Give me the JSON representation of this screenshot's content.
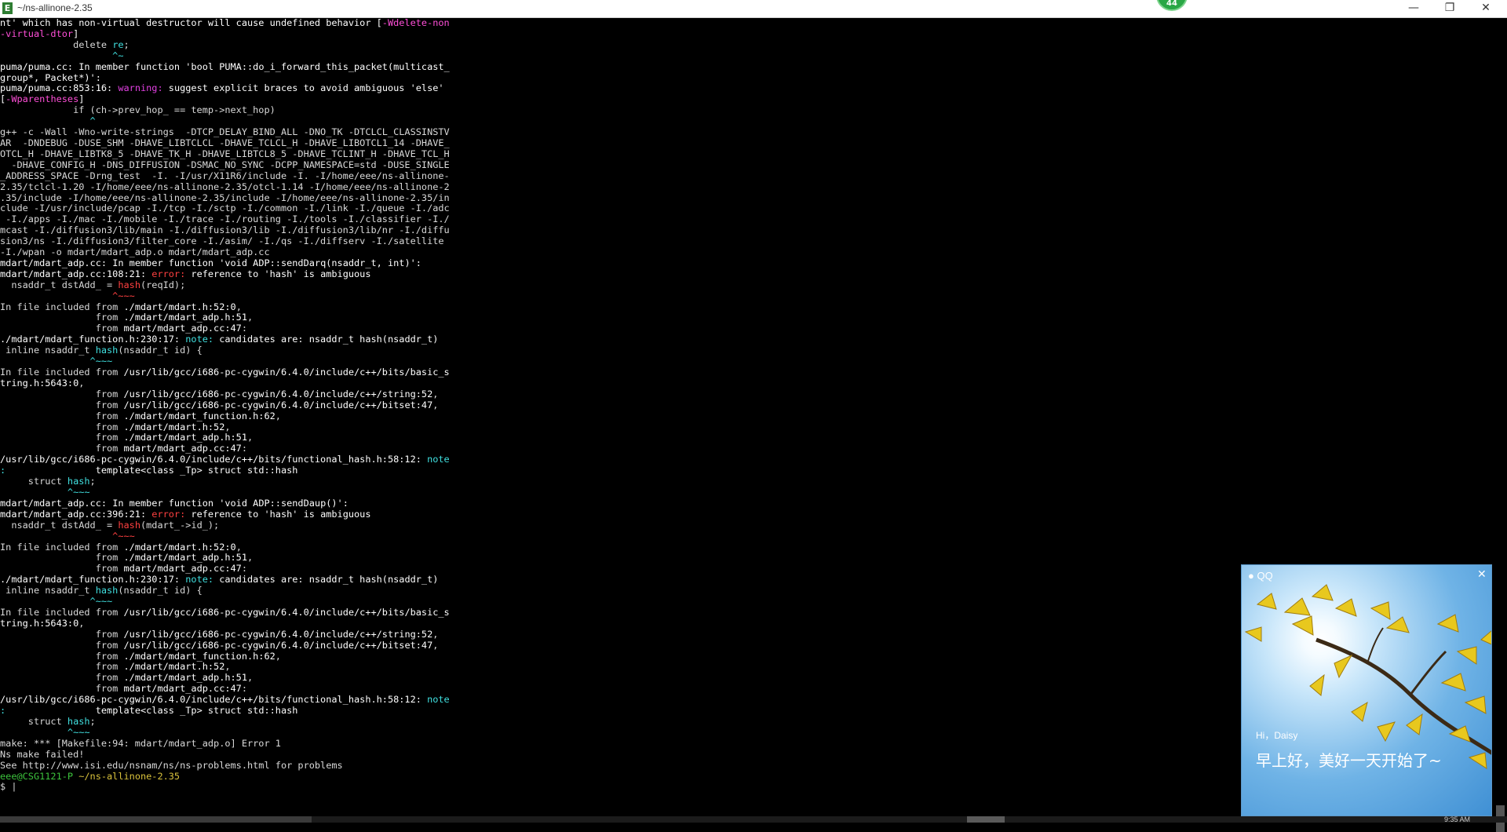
{
  "window": {
    "title": "~/ns-allinone-2.35",
    "app_icon": "E",
    "badge": "44",
    "minimize_icon": "—",
    "restore_icon": "❐",
    "close_icon": "✕"
  },
  "terminal": {
    "lines": [
      [
        [
          "nt' which has non-virtual destructor will cause undefined behavior [",
          "#ffffff"
        ],
        [
          "-Wdelete-non",
          "#ff4fd8"
        ]
      ],
      [
        [
          "-virtual-dtor",
          "#ff4fd8"
        ],
        [
          "]",
          "#ffffff"
        ]
      ],
      [
        [
          "             delete ",
          "#d9d9d9"
        ],
        [
          "re",
          "#40e0e0"
        ],
        [
          ";",
          "#d9d9d9"
        ]
      ],
      [
        [
          "                    ^~",
          "#40e0e0"
        ]
      ],
      [
        [
          "puma/puma.cc:",
          "#ffffff"
        ],
        [
          " In member function 'bool PUMA::do_i_forward_this_packet(multicast_",
          "#ffffff"
        ]
      ],
      [
        [
          "group*, Packet*)':",
          "#ffffff"
        ]
      ],
      [
        [
          "puma/puma.cc:853:16: ",
          "#ffffff"
        ],
        [
          "warning: ",
          "#e040e0"
        ],
        [
          "suggest explicit braces to avoid ambiguous 'else'",
          "#ffffff"
        ]
      ],
      [
        [
          "[",
          "#ffffff"
        ],
        [
          "-Wparentheses",
          "#ff4fd8"
        ],
        [
          "]",
          "#ffffff"
        ]
      ],
      [
        [
          "             if (ch->prev_hop_ == temp->next_hop)",
          "#d9d9d9"
        ]
      ],
      [
        [
          "                ^",
          "#40e0e0"
        ]
      ],
      [
        [
          "g++ -c -Wall -Wno-write-strings  -DTCP_DELAY_BIND_ALL -DNO_TK -DTCLCL_CLASSINSTV",
          "#d9d9d9"
        ]
      ],
      [
        [
          "AR  -DNDEBUG -DUSE_SHM -DHAVE_LIBTCLCL -DHAVE_TCLCL_H -DHAVE_LIBOTCL1_14 -DHAVE_",
          "#d9d9d9"
        ]
      ],
      [
        [
          "OTCL_H -DHAVE_LIBTK8_5 -DHAVE_TK_H -DHAVE_LIBTCL8_5 -DHAVE_TCLINT_H -DHAVE_TCL_H",
          "#d9d9d9"
        ]
      ],
      [
        [
          "  -DHAVE_CONFIG_H -DNS_DIFFUSION -DSMAC_NO_SYNC -DCPP_NAMESPACE=std -DUSE_SINGLE",
          "#d9d9d9"
        ]
      ],
      [
        [
          "_ADDRESS_SPACE -Drng_test  -I. -I/usr/X11R6/include -I. -I/home/eee/ns-allinone-",
          "#d9d9d9"
        ]
      ],
      [
        [
          "2.35/tclcl-1.20 -I/home/eee/ns-allinone-2.35/otcl-1.14 -I/home/eee/ns-allinone-2",
          "#d9d9d9"
        ]
      ],
      [
        [
          ".35/include -I/home/eee/ns-allinone-2.35/include -I/home/eee/ns-allinone-2.35/in",
          "#d9d9d9"
        ]
      ],
      [
        [
          "clude -I/usr/include/pcap -I./tcp -I./sctp -I./common -I./link -I./queue -I./adc",
          "#d9d9d9"
        ]
      ],
      [
        [
          " -I./apps -I./mac -I./mobile -I./trace -I./routing -I./tools -I./classifier -I./",
          "#d9d9d9"
        ]
      ],
      [
        [
          "mcast -I./diffusion3/lib/main -I./diffusion3/lib -I./diffusion3/lib/nr -I./diffu",
          "#d9d9d9"
        ]
      ],
      [
        [
          "sion3/ns -I./diffusion3/filter_core -I./asim/ -I./qs -I./diffserv -I./satellite",
          "#d9d9d9"
        ]
      ],
      [
        [
          "-I./wpan -o mdart/mdart_adp.o mdart/mdart_adp.cc",
          "#d9d9d9"
        ]
      ],
      [
        [
          "mdart/mdart_adp.cc:",
          "#ffffff"
        ],
        [
          " In member function 'void ADP::sendDarq(nsaddr_t, int)':",
          "#ffffff"
        ]
      ],
      [
        [
          "mdart/mdart_adp.cc:108:21: ",
          "#ffffff"
        ],
        [
          "error: ",
          "#ff4040"
        ],
        [
          "reference to 'hash' is ambiguous",
          "#ffffff"
        ]
      ],
      [
        [
          "  nsaddr_t dstAdd_ = ",
          "#d9d9d9"
        ],
        [
          "hash",
          "#ff4040"
        ],
        [
          "(reqId);",
          "#d9d9d9"
        ]
      ],
      [
        [
          "                    ^~~~",
          "#ff4040"
        ]
      ],
      [
        [
          "In file included from ",
          "#d9d9d9"
        ],
        [
          "./mdart/mdart.h:52:0",
          "#ffffff"
        ],
        [
          ",",
          "#d9d9d9"
        ]
      ],
      [
        [
          "                 from ",
          "#d9d9d9"
        ],
        [
          "./mdart/mdart_adp.h:51",
          "#ffffff"
        ],
        [
          ",",
          "#d9d9d9"
        ]
      ],
      [
        [
          "                 from ",
          "#d9d9d9"
        ],
        [
          "mdart/mdart_adp.cc:47",
          "#ffffff"
        ],
        [
          ":",
          "#d9d9d9"
        ]
      ],
      [
        [
          "./mdart/mdart_function.h:230:17: ",
          "#ffffff"
        ],
        [
          "note: ",
          "#40e0e0"
        ],
        [
          "candidates are: nsaddr_t hash(nsaddr_t)",
          "#ffffff"
        ]
      ],
      [
        [
          " inline nsaddr_t ",
          "#d9d9d9"
        ],
        [
          "hash",
          "#40e0e0"
        ],
        [
          "(nsaddr_t id) {",
          "#d9d9d9"
        ]
      ],
      [
        [
          "                ^~~~",
          "#40e0e0"
        ]
      ],
      [
        [
          "In file included from ",
          "#d9d9d9"
        ],
        [
          "/usr/lib/gcc/i686-pc-cygwin/6.4.0/include/c++/bits/basic_s",
          "#ffffff"
        ]
      ],
      [
        [
          "tring.h:5643:0",
          "#ffffff"
        ],
        [
          ",",
          "#d9d9d9"
        ]
      ],
      [
        [
          "                 from ",
          "#d9d9d9"
        ],
        [
          "/usr/lib/gcc/i686-pc-cygwin/6.4.0/include/c++/string:52",
          "#ffffff"
        ],
        [
          ",",
          "#d9d9d9"
        ]
      ],
      [
        [
          "                 from ",
          "#d9d9d9"
        ],
        [
          "/usr/lib/gcc/i686-pc-cygwin/6.4.0/include/c++/bitset:47",
          "#ffffff"
        ],
        [
          ",",
          "#d9d9d9"
        ]
      ],
      [
        [
          "                 from ",
          "#d9d9d9"
        ],
        [
          "./mdart/mdart_function.h:62",
          "#ffffff"
        ],
        [
          ",",
          "#d9d9d9"
        ]
      ],
      [
        [
          "                 from ",
          "#d9d9d9"
        ],
        [
          "./mdart/mdart.h:52",
          "#ffffff"
        ],
        [
          ",",
          "#d9d9d9"
        ]
      ],
      [
        [
          "                 from ",
          "#d9d9d9"
        ],
        [
          "./mdart/mdart_adp.h:51",
          "#ffffff"
        ],
        [
          ",",
          "#d9d9d9"
        ]
      ],
      [
        [
          "                 from ",
          "#d9d9d9"
        ],
        [
          "mdart/mdart_adp.cc:47",
          "#ffffff"
        ],
        [
          ":",
          "#d9d9d9"
        ]
      ],
      [
        [
          "/usr/lib/gcc/i686-pc-cygwin/6.4.0/include/c++/bits/functional_hash.h:58:12: ",
          "#ffffff"
        ],
        [
          "note",
          "#40e0e0"
        ]
      ],
      [
        [
          ":",
          "#40e0e0"
        ],
        [
          "                template<class _Tp> struct std::hash",
          "#ffffff"
        ]
      ],
      [
        [
          "     struct ",
          "#d9d9d9"
        ],
        [
          "hash",
          "#40e0e0"
        ],
        [
          ";",
          "#d9d9d9"
        ]
      ],
      [
        [
          "            ^~~~",
          "#40e0e0"
        ]
      ],
      [
        [
          "mdart/mdart_adp.cc:",
          "#ffffff"
        ],
        [
          " In member function 'void ADP::sendDaup()':",
          "#ffffff"
        ]
      ],
      [
        [
          "mdart/mdart_adp.cc:396:21: ",
          "#ffffff"
        ],
        [
          "error: ",
          "#ff4040"
        ],
        [
          "reference to 'hash' is ambiguous",
          "#ffffff"
        ]
      ],
      [
        [
          "  nsaddr_t dstAdd_ = ",
          "#d9d9d9"
        ],
        [
          "hash",
          "#ff4040"
        ],
        [
          "(mdart_->id_);",
          "#d9d9d9"
        ]
      ],
      [
        [
          "                    ^~~~",
          "#ff4040"
        ]
      ],
      [
        [
          "In file included from ",
          "#d9d9d9"
        ],
        [
          "./mdart/mdart.h:52:0",
          "#ffffff"
        ],
        [
          ",",
          "#d9d9d9"
        ]
      ],
      [
        [
          "                 from ",
          "#d9d9d9"
        ],
        [
          "./mdart/mdart_adp.h:51",
          "#ffffff"
        ],
        [
          ",",
          "#d9d9d9"
        ]
      ],
      [
        [
          "                 from ",
          "#d9d9d9"
        ],
        [
          "mdart/mdart_adp.cc:47",
          "#ffffff"
        ],
        [
          ":",
          "#d9d9d9"
        ]
      ],
      [
        [
          "./mdart/mdart_function.h:230:17: ",
          "#ffffff"
        ],
        [
          "note: ",
          "#40e0e0"
        ],
        [
          "candidates are: nsaddr_t hash(nsaddr_t)",
          "#ffffff"
        ]
      ],
      [
        [
          " inline nsaddr_t ",
          "#d9d9d9"
        ],
        [
          "hash",
          "#40e0e0"
        ],
        [
          "(nsaddr_t id) {",
          "#d9d9d9"
        ]
      ],
      [
        [
          "                ^~~~",
          "#40e0e0"
        ]
      ],
      [
        [
          "In file included from ",
          "#d9d9d9"
        ],
        [
          "/usr/lib/gcc/i686-pc-cygwin/6.4.0/include/c++/bits/basic_s",
          "#ffffff"
        ]
      ],
      [
        [
          "tring.h:5643:0",
          "#ffffff"
        ],
        [
          ",",
          "#d9d9d9"
        ]
      ],
      [
        [
          "                 from ",
          "#d9d9d9"
        ],
        [
          "/usr/lib/gcc/i686-pc-cygwin/6.4.0/include/c++/string:52",
          "#ffffff"
        ],
        [
          ",",
          "#d9d9d9"
        ]
      ],
      [
        [
          "                 from ",
          "#d9d9d9"
        ],
        [
          "/usr/lib/gcc/i686-pc-cygwin/6.4.0/include/c++/bitset:47",
          "#ffffff"
        ],
        [
          ",",
          "#d9d9d9"
        ]
      ],
      [
        [
          "                 from ",
          "#d9d9d9"
        ],
        [
          "./mdart/mdart_function.h:62",
          "#ffffff"
        ],
        [
          ",",
          "#d9d9d9"
        ]
      ],
      [
        [
          "                 from ",
          "#d9d9d9"
        ],
        [
          "./mdart/mdart.h:52",
          "#ffffff"
        ],
        [
          ",",
          "#d9d9d9"
        ]
      ],
      [
        [
          "                 from ",
          "#d9d9d9"
        ],
        [
          "./mdart/mdart_adp.h:51",
          "#ffffff"
        ],
        [
          ",",
          "#d9d9d9"
        ]
      ],
      [
        [
          "                 from ",
          "#d9d9d9"
        ],
        [
          "mdart/mdart_adp.cc:47",
          "#ffffff"
        ],
        [
          ":",
          "#d9d9d9"
        ]
      ],
      [
        [
          "/usr/lib/gcc/i686-pc-cygwin/6.4.0/include/c++/bits/functional_hash.h:58:12: ",
          "#ffffff"
        ],
        [
          "note",
          "#40e0e0"
        ]
      ],
      [
        [
          ":",
          "#40e0e0"
        ],
        [
          "                template<class _Tp> struct std::hash",
          "#ffffff"
        ]
      ],
      [
        [
          "     struct ",
          "#d9d9d9"
        ],
        [
          "hash",
          "#40e0e0"
        ],
        [
          ";",
          "#d9d9d9"
        ]
      ],
      [
        [
          "            ^~~~",
          "#40e0e0"
        ]
      ],
      [
        [
          "make: *** [Makefile:94: mdart/mdart_adp.o] Error 1",
          "#d9d9d9"
        ]
      ],
      [
        [
          "Ns make failed!",
          "#d9d9d9"
        ]
      ],
      [
        [
          "See http://www.isi.edu/nsnam/ns/ns-problems.html for problems",
          "#d9d9d9"
        ]
      ],
      [
        [
          "",
          "#d9d9d9"
        ]
      ],
      [
        [
          "eee@CSG1121-P ",
          "#3cc23c"
        ],
        [
          "~/ns-allinone-2.35",
          "#d9c23c"
        ]
      ],
      [
        [
          "$ ",
          "#d9d9d9"
        ],
        [
          "|",
          "#d9d9d9"
        ]
      ]
    ]
  },
  "qq_popup": {
    "app_name": "QQ",
    "close_icon": "✕",
    "greeting": "Hi，Daisy",
    "message": "早上好，美好一天开始了~"
  },
  "taskbar": {
    "time": "9:35 AM"
  }
}
